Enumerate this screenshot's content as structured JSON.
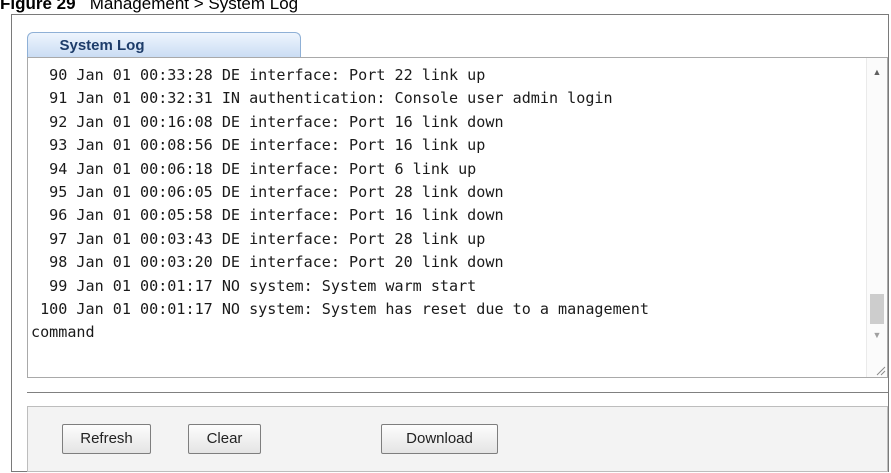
{
  "caption": {
    "figure": "Figure 29",
    "title": "Management > System Log"
  },
  "tab": {
    "label": "System Log"
  },
  "log": {
    "lines": [
      "  90 Jan 01 00:33:28 DE interface: Port 22 link up",
      "  91 Jan 01 00:32:31 IN authentication: Console user admin login",
      "  92 Jan 01 00:16:08 DE interface: Port 16 link down",
      "  93 Jan 01 00:08:56 DE interface: Port 16 link up",
      "  94 Jan 01 00:06:18 DE interface: Port 6 link up",
      "  95 Jan 01 00:06:05 DE interface: Port 28 link down",
      "  96 Jan 01 00:05:58 DE interface: Port 16 link down",
      "  97 Jan 01 00:03:43 DE interface: Port 28 link up",
      "  98 Jan 01 00:03:20 DE interface: Port 20 link down",
      "  99 Jan 01 00:01:17 NO system: System warm start",
      " 100 Jan 01 00:01:17 NO system: System has reset due to a management",
      "command"
    ],
    "scroll_position": 0.95
  },
  "buttons": {
    "refresh": "Refresh",
    "clear": "Clear",
    "download": "Download"
  },
  "icons": {
    "scroll_up": "scroll-up-arrow",
    "scroll_down": "scroll-down-arrow",
    "resize": "resize-grip"
  },
  "colors": {
    "tab_text": "#1d3c6a",
    "tab_gradient_top": "#eef5fd",
    "tab_gradient_bottom": "#c9dcf3"
  }
}
